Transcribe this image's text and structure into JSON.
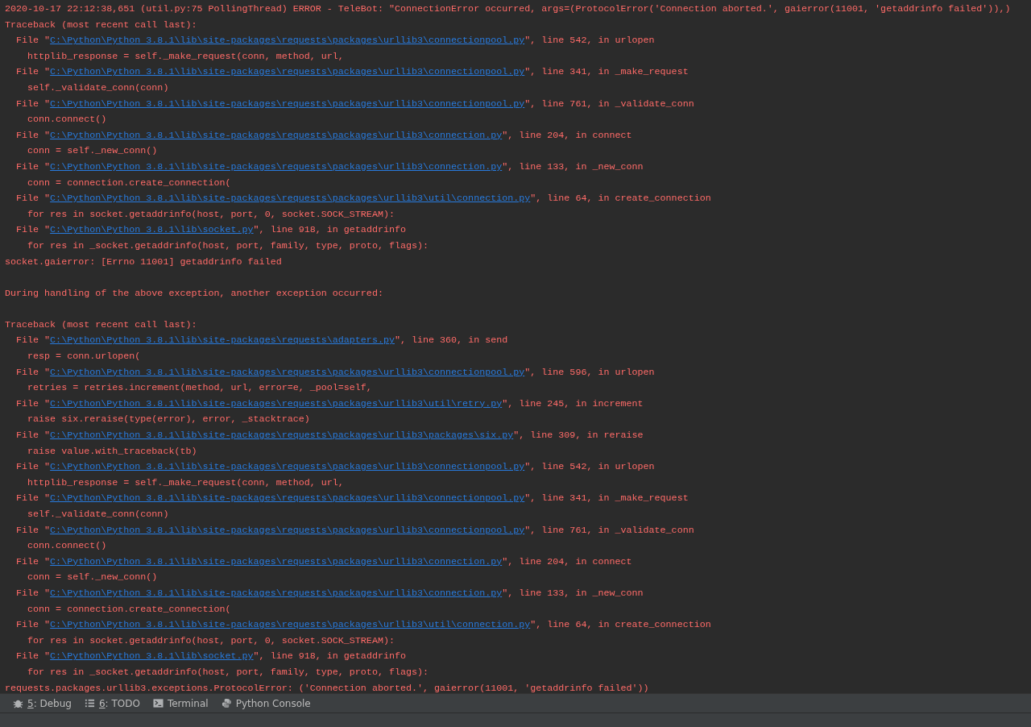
{
  "console": {
    "lines": [
      {
        "kind": "text",
        "text": "2020-10-17 22:12:38,651 (util.py:75 PollingThread) ERROR - TeleBot: \"ConnectionError occurred, args=(ProtocolError('Connection aborted.', gaierror(11001, 'getaddrinfo failed')),)"
      },
      {
        "kind": "text",
        "text": "Traceback (most recent call last):"
      },
      {
        "kind": "file",
        "pre": "  File \"",
        "path": "C:\\Python\\Python 3.8.1\\lib\\site-packages\\requests\\packages\\urllib3\\connectionpool.py",
        "post": "\", line 542, in urlopen"
      },
      {
        "kind": "text",
        "text": "    httplib_response = self._make_request(conn, method, url,"
      },
      {
        "kind": "file",
        "pre": "  File \"",
        "path": "C:\\Python\\Python 3.8.1\\lib\\site-packages\\requests\\packages\\urllib3\\connectionpool.py",
        "post": "\", line 341, in _make_request"
      },
      {
        "kind": "text",
        "text": "    self._validate_conn(conn)"
      },
      {
        "kind": "file",
        "pre": "  File \"",
        "path": "C:\\Python\\Python 3.8.1\\lib\\site-packages\\requests\\packages\\urllib3\\connectionpool.py",
        "post": "\", line 761, in _validate_conn"
      },
      {
        "kind": "text",
        "text": "    conn.connect()"
      },
      {
        "kind": "file",
        "pre": "  File \"",
        "path": "C:\\Python\\Python 3.8.1\\lib\\site-packages\\requests\\packages\\urllib3\\connection.py",
        "post": "\", line 204, in connect"
      },
      {
        "kind": "text",
        "text": "    conn = self._new_conn()"
      },
      {
        "kind": "file",
        "pre": "  File \"",
        "path": "C:\\Python\\Python 3.8.1\\lib\\site-packages\\requests\\packages\\urllib3\\connection.py",
        "post": "\", line 133, in _new_conn"
      },
      {
        "kind": "text",
        "text": "    conn = connection.create_connection("
      },
      {
        "kind": "file",
        "pre": "  File \"",
        "path": "C:\\Python\\Python 3.8.1\\lib\\site-packages\\requests\\packages\\urllib3\\util\\connection.py",
        "post": "\", line 64, in create_connection"
      },
      {
        "kind": "text",
        "text": "    for res in socket.getaddrinfo(host, port, 0, socket.SOCK_STREAM):"
      },
      {
        "kind": "file",
        "pre": "  File \"",
        "path": "C:\\Python\\Python 3.8.1\\lib\\socket.py",
        "post": "\", line 918, in getaddrinfo"
      },
      {
        "kind": "text",
        "text": "    for res in _socket.getaddrinfo(host, port, family, type, proto, flags):"
      },
      {
        "kind": "text",
        "text": "socket.gaierror: [Errno 11001] getaddrinfo failed"
      },
      {
        "kind": "blank"
      },
      {
        "kind": "text",
        "text": "During handling of the above exception, another exception occurred:"
      },
      {
        "kind": "blank"
      },
      {
        "kind": "text",
        "text": "Traceback (most recent call last):"
      },
      {
        "kind": "file",
        "pre": "  File \"",
        "path": "C:\\Python\\Python 3.8.1\\lib\\site-packages\\requests\\adapters.py",
        "post": "\", line 360, in send"
      },
      {
        "kind": "text",
        "text": "    resp = conn.urlopen("
      },
      {
        "kind": "file",
        "pre": "  File \"",
        "path": "C:\\Python\\Python 3.8.1\\lib\\site-packages\\requests\\packages\\urllib3\\connectionpool.py",
        "post": "\", line 596, in urlopen"
      },
      {
        "kind": "text",
        "text": "    retries = retries.increment(method, url, error=e, _pool=self,"
      },
      {
        "kind": "file",
        "pre": "  File \"",
        "path": "C:\\Python\\Python 3.8.1\\lib\\site-packages\\requests\\packages\\urllib3\\util\\retry.py",
        "post": "\", line 245, in increment"
      },
      {
        "kind": "text",
        "text": "    raise six.reraise(type(error), error, _stacktrace)"
      },
      {
        "kind": "file",
        "pre": "  File \"",
        "path": "C:\\Python\\Python 3.8.1\\lib\\site-packages\\requests\\packages\\urllib3\\packages\\six.py",
        "post": "\", line 309, in reraise"
      },
      {
        "kind": "text",
        "text": "    raise value.with_traceback(tb)"
      },
      {
        "kind": "file",
        "pre": "  File \"",
        "path": "C:\\Python\\Python 3.8.1\\lib\\site-packages\\requests\\packages\\urllib3\\connectionpool.py",
        "post": "\", line 542, in urlopen"
      },
      {
        "kind": "text",
        "text": "    httplib_response = self._make_request(conn, method, url,"
      },
      {
        "kind": "file",
        "pre": "  File \"",
        "path": "C:\\Python\\Python 3.8.1\\lib\\site-packages\\requests\\packages\\urllib3\\connectionpool.py",
        "post": "\", line 341, in _make_request"
      },
      {
        "kind": "text",
        "text": "    self._validate_conn(conn)"
      },
      {
        "kind": "file",
        "pre": "  File \"",
        "path": "C:\\Python\\Python 3.8.1\\lib\\site-packages\\requests\\packages\\urllib3\\connectionpool.py",
        "post": "\", line 761, in _validate_conn"
      },
      {
        "kind": "text",
        "text": "    conn.connect()"
      },
      {
        "kind": "file",
        "pre": "  File \"",
        "path": "C:\\Python\\Python 3.8.1\\lib\\site-packages\\requests\\packages\\urllib3\\connection.py",
        "post": "\", line 204, in connect"
      },
      {
        "kind": "text",
        "text": "    conn = self._new_conn()"
      },
      {
        "kind": "file",
        "pre": "  File \"",
        "path": "C:\\Python\\Python 3.8.1\\lib\\site-packages\\requests\\packages\\urllib3\\connection.py",
        "post": "\", line 133, in _new_conn"
      },
      {
        "kind": "text",
        "text": "    conn = connection.create_connection("
      },
      {
        "kind": "file",
        "pre": "  File \"",
        "path": "C:\\Python\\Python 3.8.1\\lib\\site-packages\\requests\\packages\\urllib3\\util\\connection.py",
        "post": "\", line 64, in create_connection"
      },
      {
        "kind": "text",
        "text": "    for res in socket.getaddrinfo(host, port, 0, socket.SOCK_STREAM):"
      },
      {
        "kind": "file",
        "pre": "  File \"",
        "path": "C:\\Python\\Python 3.8.1\\lib\\socket.py",
        "post": "\", line 918, in getaddrinfo"
      },
      {
        "kind": "text",
        "text": "    for res in _socket.getaddrinfo(host, port, family, type, proto, flags):"
      },
      {
        "kind": "text",
        "text": "requests.packages.urllib3.exceptions.ProtocolError: ('Connection aborted.', gaierror(11001, 'getaddrinfo failed'))"
      }
    ]
  },
  "tool_windows": [
    {
      "kind": "debug",
      "key": "5",
      "label": ": Debug"
    },
    {
      "kind": "todo",
      "key": "6",
      "label": ": TODO"
    },
    {
      "kind": "terminal",
      "label": "Terminal"
    },
    {
      "kind": "python",
      "label": "Python Console"
    }
  ]
}
